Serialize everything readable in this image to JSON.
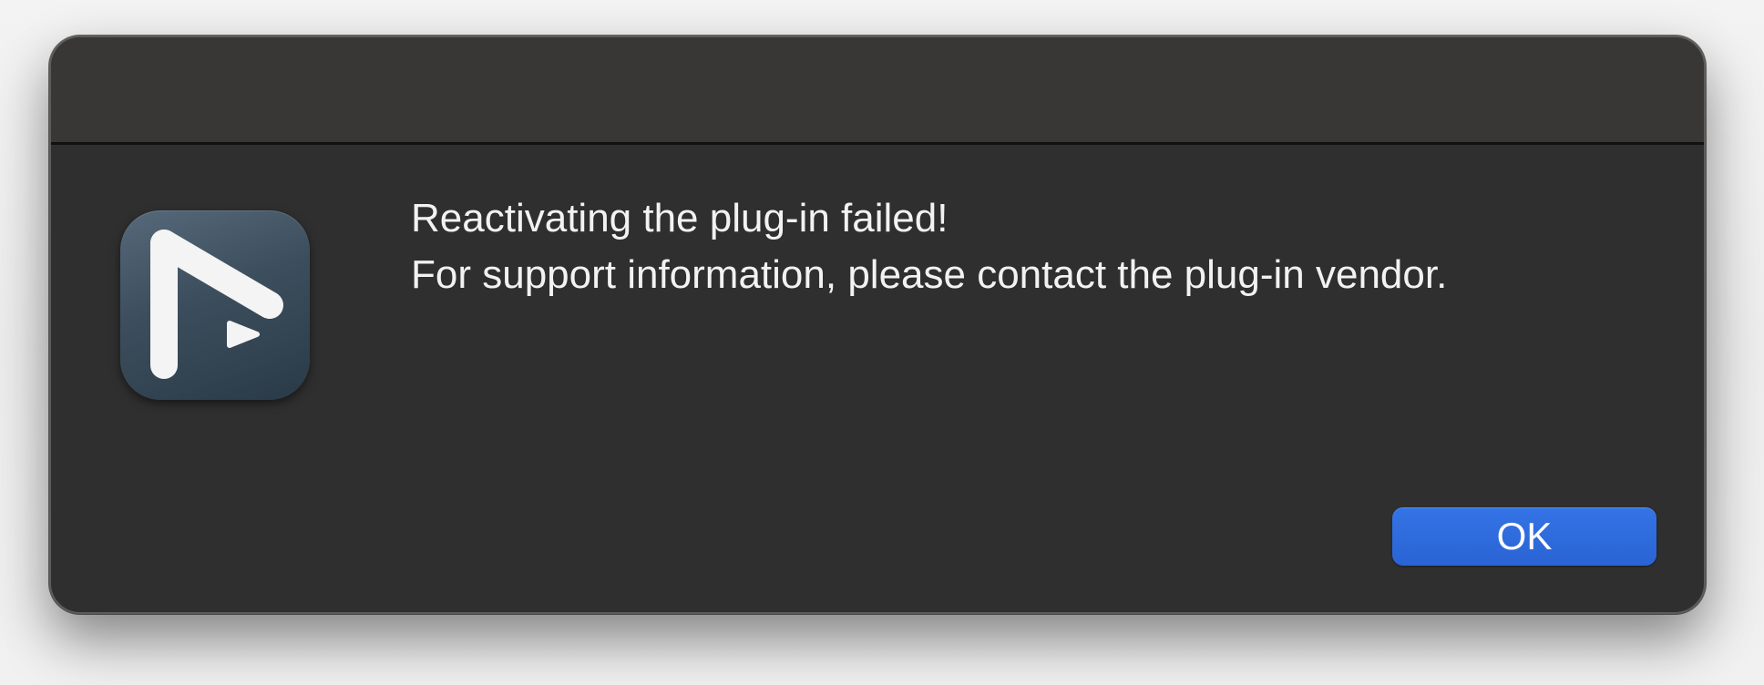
{
  "dialog": {
    "title": "",
    "message_lines": [
      "Reactivating the plug-in failed!",
      "For support information, please contact the plug-in vendor."
    ],
    "app_icon": "playback-triangle-app-icon",
    "ok_label": "OK"
  },
  "colors": {
    "dialog_background": "#2f2f2f",
    "titlebar_background": "#383735",
    "text": "#f2f2f2",
    "accent_button": "#2a63d4",
    "icon_background": "#3c4e5d"
  }
}
